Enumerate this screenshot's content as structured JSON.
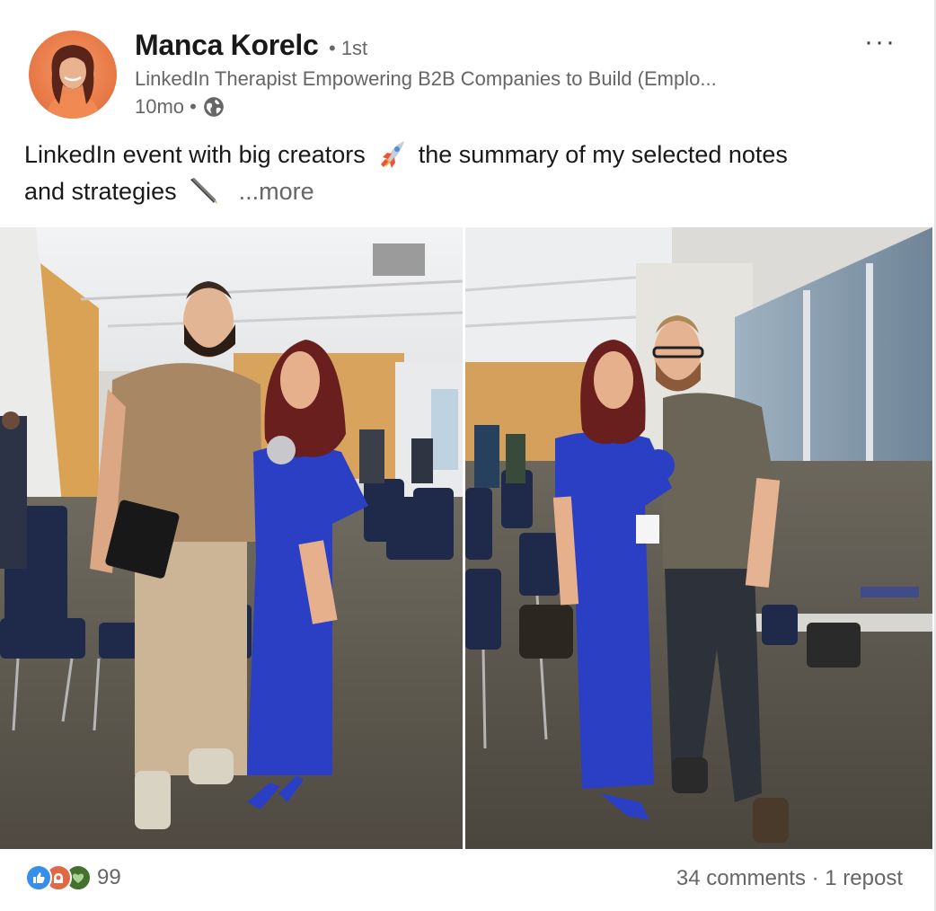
{
  "post": {
    "author": {
      "name": "Manca Korelc",
      "degree": "• 1st",
      "headline": "LinkedIn Therapist Empowering B2B Companies to Build (Emplo...",
      "time": "10mo •",
      "visibility_icon": "globe-icon"
    },
    "more_menu_label": "···",
    "text": {
      "part1": "LinkedIn event with big creators",
      "part2": "the summary of my selected notes and strategies",
      "see_more": "...more",
      "emoji_1": "rocket-icon",
      "emoji_2": "pen-icon"
    },
    "photos": [
      {
        "name": "event-photo-left"
      },
      {
        "name": "event-photo-right"
      }
    ],
    "reactions": {
      "icons": [
        "like-icon",
        "celebrate-icon",
        "support-icon"
      ],
      "count": "99"
    },
    "social_counts": {
      "comments": "34 comments",
      "separator": " · ",
      "reposts": "1 repost"
    }
  },
  "colors": {
    "text_primary": "#191919",
    "text_secondary": "#666666",
    "like_blue": "#378fe9",
    "celebrate_orange": "#e06847",
    "support_green": "#44712e",
    "dress_blue": "#2b3fc4"
  }
}
